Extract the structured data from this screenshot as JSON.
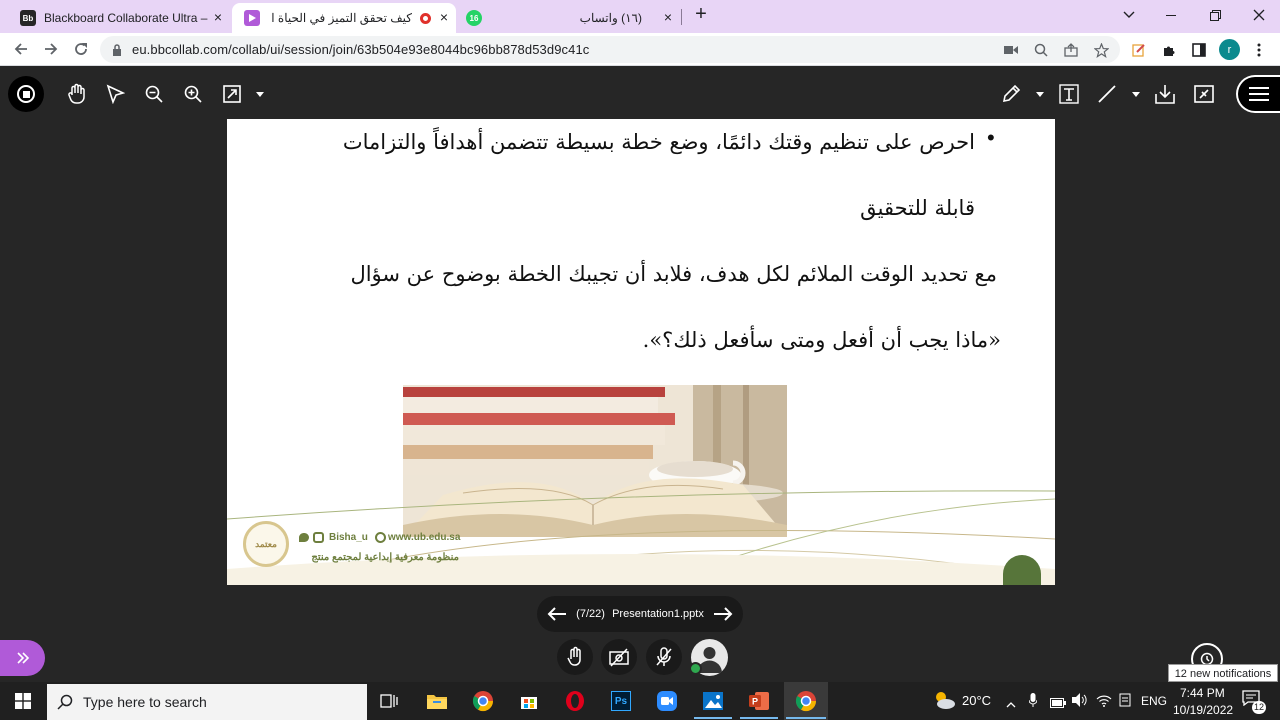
{
  "browser": {
    "tabs": [
      {
        "favicon": "Bb",
        "title": "Blackboard Collaborate Ultra – ...",
        "close": "×"
      },
      {
        "favicon": "play-icon",
        "title": "كيف تحقق التميز في الحياة الج",
        "close": "×"
      },
      {
        "favicon": "whatsapp-icon",
        "badge": "16",
        "title": "(١٦) واتساب",
        "close": "×"
      }
    ],
    "new_tab": "+",
    "url": "eu.bbcollab.com/collab/ui/session/join/63b504e93e8044bc96bb878d53d9c41c",
    "profile_initial": "r"
  },
  "slide": {
    "bullet": "•",
    "lines": [
      "احرص على تنظيم وقتك دائمًا، وضع خطة بسيطة تتضمن أهدافاً والتزامات",
      "قابلة للتحقيق",
      "مع تحديد الوقت الملائم لكل هدف، فلابد أن تجيبك الخطة بوضوح عن سؤال",
      "«ماذا يجب أن أفعل ومتى سأفعل ذلك؟»."
    ],
    "footer_social": "Bisha_u",
    "footer_web": "www.ub.edu.sa",
    "footer_tagline": "منظومة معرفية إبداعية لمجتمع منتج",
    "logo_text": "معتمد"
  },
  "presentation": {
    "page": "(7/22)",
    "file": "Presentation1.pptx"
  },
  "notifications": "12 new notifications",
  "taskbar": {
    "search_placeholder": "Type here to search",
    "temperature": "20°C",
    "language": "ENG",
    "time": "7:44 PM",
    "date": "10/19/2022",
    "notification_count": "12"
  },
  "colors": {
    "tabstrip": "#e8d5f6",
    "app_bg": "#262626",
    "accent_purple": "#b05ad8",
    "profile": "#0b8a8e"
  }
}
